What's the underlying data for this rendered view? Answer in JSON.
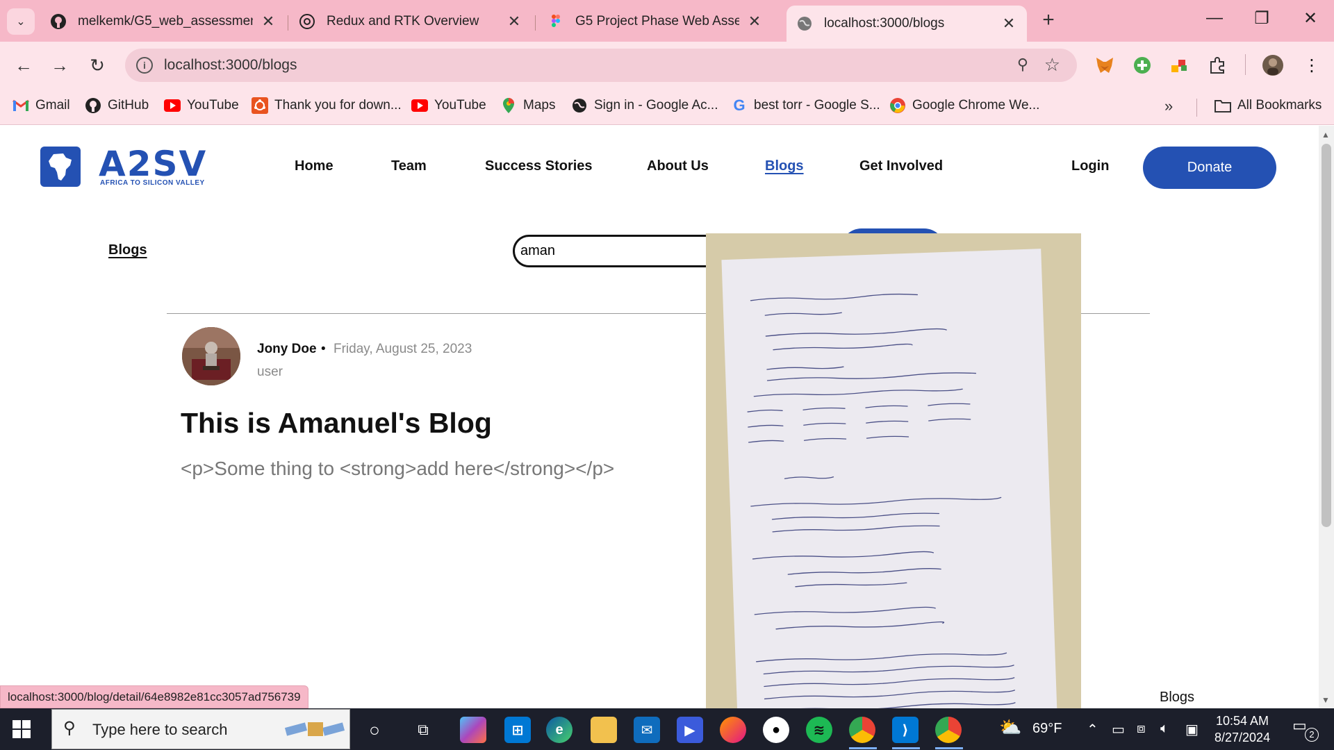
{
  "browser": {
    "tabs": [
      {
        "title": "melkemk/G5_web_assessment",
        "icon": "github-icon"
      },
      {
        "title": "Redux and RTK Overview",
        "icon": "chatgpt-icon"
      },
      {
        "title": "G5 Project Phase Web Assessme",
        "icon": "figma-icon"
      },
      {
        "title": "localhost:3000/blogs",
        "icon": "globe-icon",
        "active": true
      }
    ],
    "new_tab_label": "+",
    "url": "localhost:3000/blogs",
    "bookmarks": [
      {
        "label": "Gmail",
        "icon": "gmail-icon"
      },
      {
        "label": "GitHub",
        "icon": "github-icon"
      },
      {
        "label": "YouTube",
        "icon": "youtube-icon"
      },
      {
        "label": "Thank you for down...",
        "icon": "ubuntu-icon"
      },
      {
        "label": "YouTube",
        "icon": "youtube-icon"
      },
      {
        "label": "Maps",
        "icon": "maps-icon"
      },
      {
        "label": "Sign in - Google Ac...",
        "icon": "globe-icon"
      },
      {
        "label": "best torr - Google S...",
        "icon": "google-icon"
      },
      {
        "label": "Google Chrome We...",
        "icon": "chrome-icon"
      }
    ],
    "more_bookmarks": "»",
    "all_bookmarks": "All Bookmarks",
    "status_url": "localhost:3000/blog/detail/64e8982e81cc3057ad756739"
  },
  "site": {
    "logo_text": "A2SV",
    "logo_subtitle": "AFRICA TO SILICON VALLEY",
    "nav": [
      {
        "label": "Home"
      },
      {
        "label": "Team"
      },
      {
        "label": "Success Stories"
      },
      {
        "label": "About Us"
      },
      {
        "label": "Blogs",
        "active": true
      },
      {
        "label": "Get Involved"
      }
    ],
    "login_label": "Login",
    "donate_label": "Donate",
    "brand_color": "#2451b3"
  },
  "blogs_page": {
    "breadcrumb": "Blogs",
    "search_value": "aman",
    "floating_label": "Blogs",
    "post": {
      "author": "Jony Doe",
      "separator": "•",
      "date": "Friday, August 25, 2023",
      "role": "user",
      "title": "This is Amanuel's Blog",
      "body": "<p>Some thing to <strong>add here</strong></p>"
    }
  },
  "taskbar": {
    "search_placeholder": "Type here to search",
    "weather": "69°F",
    "time": "10:54 AM",
    "date": "8/27/2024",
    "notification_count": "2"
  }
}
